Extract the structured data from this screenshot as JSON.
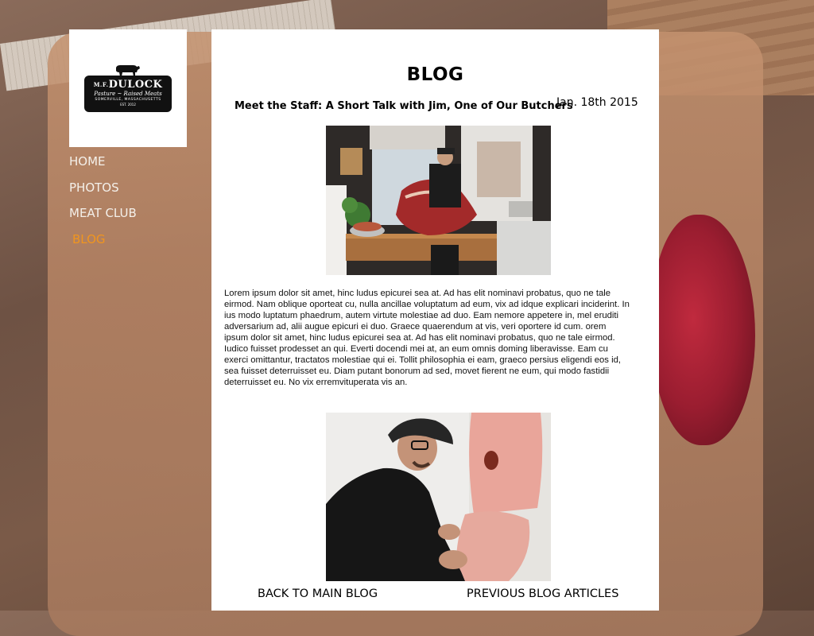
{
  "logo": {
    "brand_prefix": "M.F.",
    "brand_name": "DULOCK",
    "tagline": "Pasture ~ Raised Meats",
    "location": "SOMERVILLE, MASSACHUSETTS",
    "est": "EST. 2012"
  },
  "nav": {
    "items": [
      {
        "label": "HOME"
      },
      {
        "label": "PHOTOS"
      },
      {
        "label": "MEAT CLUB"
      },
      {
        "label": "BLOG"
      }
    ],
    "active_color": "#f0951f"
  },
  "page": {
    "heading": "BLOG",
    "post_title": "Meet the Staff: A Short Talk with Jim, One of Our Butchers",
    "post_date": "Jan. 18th 2015",
    "paragraphs": [
      "Lorem ipsum dolor sit amet, hinc ludus epicurei sea at. Ad has elit nominavi probatus, quo ne tale eirmod. Nam oblique oporteat cu, nulla ancillae voluptatum ad eum, vix ad idque explicari inciderint. In ius modo luptatum phaedrum, autem virtute molestiae ad duo. Eam nemore appetere in, mel eruditi adversarium ad, alii augue epicuri ei duo. Graece quaerendum at vis, veri oportere id cum. orem ipsum dolor sit amet, hinc ludus epicurei sea at. Ad has elit nominavi probatus, quo ne tale eirmod.",
      "Iudico fuisset prodesset an qui. Everti docendi mei at, an eum omnis doming liberavisse. Eam cu exerci omittantur, tractatos molestiae qui ei. Tollit philosophia ei eam, graeco persius eligendi eos id, sea fuisset deterruisset eu. Diam putant bonorum ad sed, movet fierent ne eum, qui modo fastidii deterruisset eu. No vix erremvituperata vis an."
    ],
    "back_link": "BACK TO MAIN BLOG",
    "previous_link": "PREVIOUS BLOG ARTICLES"
  }
}
